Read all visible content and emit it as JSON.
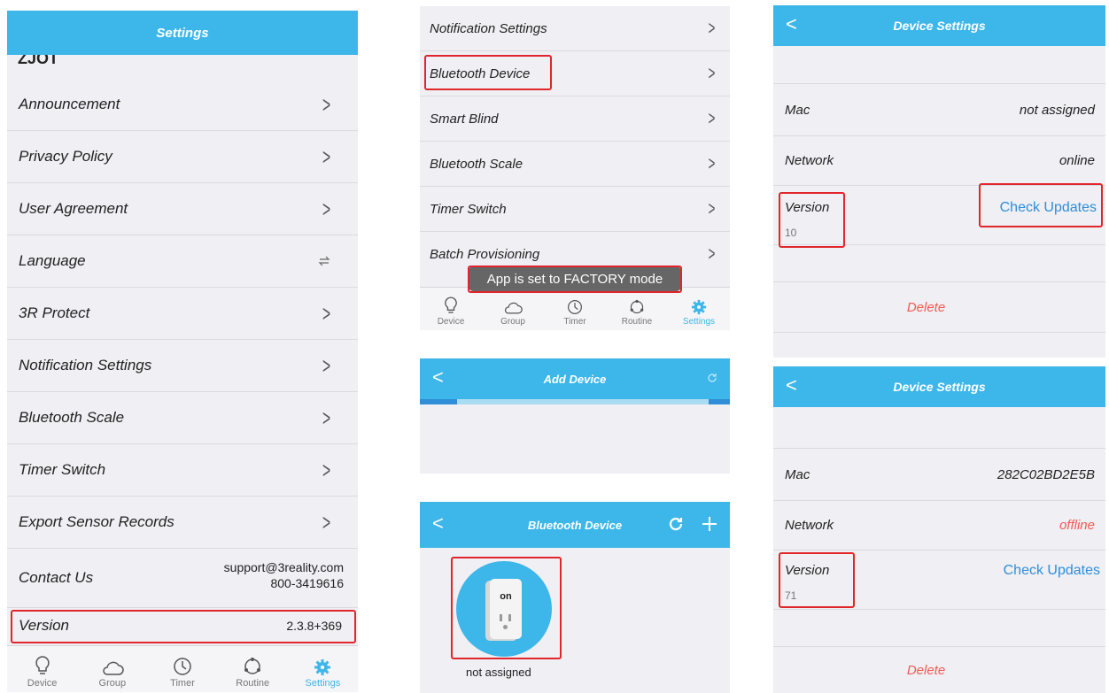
{
  "panel1": {
    "header_title": "Settings",
    "partial_text": "ZJOT",
    "items": [
      {
        "label": "Announcement"
      },
      {
        "label": "Privacy Policy"
      },
      {
        "label": "User Agreement"
      },
      {
        "label": "Language"
      },
      {
        "label": "3R Protect"
      },
      {
        "label": "Notification Settings"
      },
      {
        "label": "Bluetooth Scale"
      },
      {
        "label": "Timer Switch"
      },
      {
        "label": "Export Sensor Records"
      }
    ],
    "contact": {
      "label": "Contact Us",
      "email": "support@3reality.com",
      "phone": "800-3419616"
    },
    "version": {
      "label": "Version",
      "value": "2.3.8+369"
    },
    "tabs": [
      "Device",
      "Group",
      "Timer",
      "Routine",
      "Settings"
    ]
  },
  "panel2": {
    "items": [
      {
        "label": "Notification Settings"
      },
      {
        "label": "Bluetooth Device"
      },
      {
        "label": "Smart Blind"
      },
      {
        "label": "Bluetooth Scale"
      },
      {
        "label": "Timer Switch"
      },
      {
        "label": "Batch Provisioning"
      }
    ],
    "toast": "App is set to FACTORY mode",
    "tabs": [
      "Device",
      "Group",
      "Timer",
      "Routine",
      "Settings"
    ]
  },
  "panel3": {
    "header_title": "Add Device"
  },
  "panel4": {
    "header_title": "Bluetooth Device",
    "device_button_text": "on",
    "device_status": "not assigned"
  },
  "panel5": {
    "header_title": "Device Settings",
    "mac_label": "Mac",
    "mac_value": "not assigned",
    "network_label": "Network",
    "network_value": "online",
    "version_label": "Version",
    "version_value": "10",
    "check_updates": "Check Updates",
    "delete": "Delete"
  },
  "panel6": {
    "header_title": "Device Settings",
    "mac_label": "Mac",
    "mac_value": "282C02BD2E5B",
    "network_label": "Network",
    "network_value": "offline",
    "version_label": "Version",
    "version_value": "71",
    "check_updates": "Check Updates",
    "delete": "Delete"
  },
  "colors": {
    "accent": "#3db6e9",
    "highlight": "#e0262a",
    "link": "#2e8ed8",
    "danger": "#f05a55"
  }
}
